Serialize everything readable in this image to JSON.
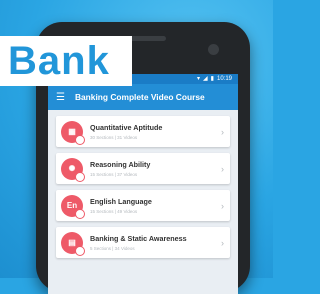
{
  "banner": {
    "text": "Bank"
  },
  "status": {
    "time": "10:19",
    "wifi_icon": "wifi-icon",
    "signal_icon": "signal-icon",
    "battery_icon": "battery-icon"
  },
  "appbar": {
    "menu_icon": "menu-icon",
    "title": "Banking Complete Video Course"
  },
  "courses": [
    {
      "title": "Quantitative Aptitude",
      "meta": "30 Sections | 31 Videos",
      "icon": "calculator-icon",
      "glyph": "▦"
    },
    {
      "title": "Reasoning Ability",
      "meta": "15 Sections | 37 Videos",
      "icon": "brain-icon",
      "glyph": "✺"
    },
    {
      "title": "English Language",
      "meta": "15 Sections | 49 Videos",
      "icon": "english-icon",
      "glyph": "En"
    },
    {
      "title": "Banking & Static Awareness",
      "meta": "5 Sections | 34 Videos",
      "icon": "bank-icon",
      "glyph": "▤"
    }
  ],
  "colors": {
    "background": "#2aa5e3",
    "appbar": "#238ed6",
    "accent": "#ee5a68",
    "brand": "#2196d9"
  }
}
